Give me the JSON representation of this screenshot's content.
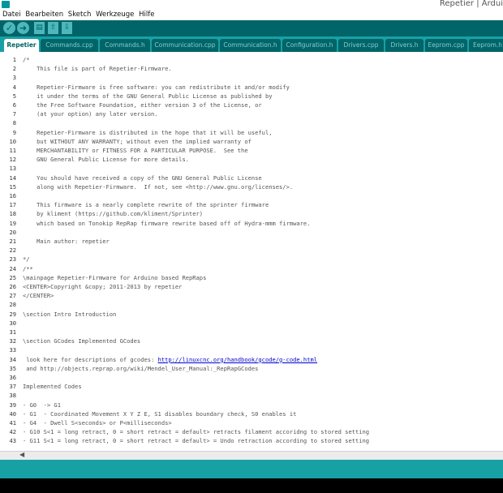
{
  "window": {
    "title": "Repetier | Ardui"
  },
  "menu": [
    "Datei",
    "Bearbeiten",
    "Sketch",
    "Werkzeuge",
    "Hilfe"
  ],
  "toolbar": {
    "verify_icon": "check-icon",
    "upload_icon": "arrow-right-icon",
    "new_icon": "new-file-icon",
    "open_icon": "arrow-up-icon",
    "save_icon": "arrow-down-icon",
    "glyphs": {
      "verify": "✓",
      "upload": "➜",
      "new": "▤",
      "open": "⇧",
      "save": "⇩"
    }
  },
  "tabs": [
    "Repetier",
    "Commands.cpp",
    "Commands.h",
    "Communication.cpp",
    "Communication.h",
    "Configuration.h",
    "Drivers.cpp",
    "Drivers.h",
    "Eeprom.cpp",
    "Eeprom.h"
  ],
  "active_tab": "Repetier",
  "colors": {
    "toolbar": "#006468",
    "tabbar": "#17a1a5",
    "link": "#0000cc"
  },
  "code_lines": [
    {
      "n": "1",
      "text": "/*"
    },
    {
      "n": "2",
      "text": "    This file is part of Repetier-Firmware."
    },
    {
      "n": "3",
      "text": ""
    },
    {
      "n": "4",
      "text": "    Repetier-Firmware is free software: you can redistribute it and/or modify"
    },
    {
      "n": "5",
      "text": "    it under the terms of the GNU General Public License as published by"
    },
    {
      "n": "6",
      "text": "    the Free Software Foundation, either version 3 of the License, or"
    },
    {
      "n": "7",
      "text": "    (at your option) any later version."
    },
    {
      "n": "8",
      "text": ""
    },
    {
      "n": "9",
      "text": "    Repetier-Firmware is distributed in the hope that it will be useful,"
    },
    {
      "n": "10",
      "text": "    but WITHOUT ANY WARRANTY; without even the implied warranty of"
    },
    {
      "n": "11",
      "text": "    MERCHANTABILITY or FITNESS FOR A PARTICULAR PURPOSE.  See the"
    },
    {
      "n": "12",
      "text": "    GNU General Public License for more details."
    },
    {
      "n": "13",
      "text": ""
    },
    {
      "n": "14",
      "text": "    You should have received a copy of the GNU General Public License"
    },
    {
      "n": "15",
      "text": "    along with Repetier-Firmware.  If not, see <http://www.gnu.org/licenses/>."
    },
    {
      "n": "16",
      "text": ""
    },
    {
      "n": "17",
      "text": "    This firmware is a nearly complete rewrite of the sprinter firmware"
    },
    {
      "n": "18",
      "text": "    by kliment (https://github.com/kliment/Sprinter)"
    },
    {
      "n": "19",
      "text": "    which based on Tonokip RepRap firmware rewrite based off of Hydra-mmm firmware."
    },
    {
      "n": "20",
      "text": ""
    },
    {
      "n": "21",
      "text": "    Main author: repetier"
    },
    {
      "n": "22",
      "text": ""
    },
    {
      "n": "23",
      "text": "*/"
    },
    {
      "n": "24",
      "text": "/**"
    },
    {
      "n": "25",
      "text": "\\mainpage Repetier-Firmware for Arduino based RepRaps"
    },
    {
      "n": "26",
      "text": "<CENTER>Copyright &copy; 2011-2013 by repetier"
    },
    {
      "n": "27",
      "text": "</CENTER>"
    },
    {
      "n": "28",
      "text": ""
    },
    {
      "n": "29",
      "text": "\\section Intro Introduction"
    },
    {
      "n": "30",
      "text": ""
    },
    {
      "n": "31",
      "text": ""
    },
    {
      "n": "32",
      "text": "\\section GCodes Implemented GCodes"
    },
    {
      "n": "33",
      "text": ""
    },
    {
      "n": "34",
      "text": " look here for descriptions of gcodes: ",
      "link": "http://linuxcnc.org/handbook/gcode/g-code.html"
    },
    {
      "n": "35",
      "text": " and http://objects.reprap.org/wiki/Mendel_User_Manual:_RepRapGCodes"
    },
    {
      "n": "36",
      "text": ""
    },
    {
      "n": "37",
      "text": "Implemented Codes"
    },
    {
      "n": "38",
      "text": ""
    },
    {
      "n": "39",
      "text": "- G0  -> G1"
    },
    {
      "n": "40",
      "text": "- G1  - Coordinated Movement X Y Z E, S1 disables boundary check, S0 enables it"
    },
    {
      "n": "41",
      "text": "- G4  - Dwell S<seconds> or P<milliseconds>"
    },
    {
      "n": "42",
      "text": "- G10 S<1 = long retract, 0 = short retract = default> retracts filament accoridng to stored setting"
    },
    {
      "n": "43",
      "text": "- G11 S<1 = long retract, 0 = short retract = default> = Undo retraction according to stored setting"
    }
  ]
}
